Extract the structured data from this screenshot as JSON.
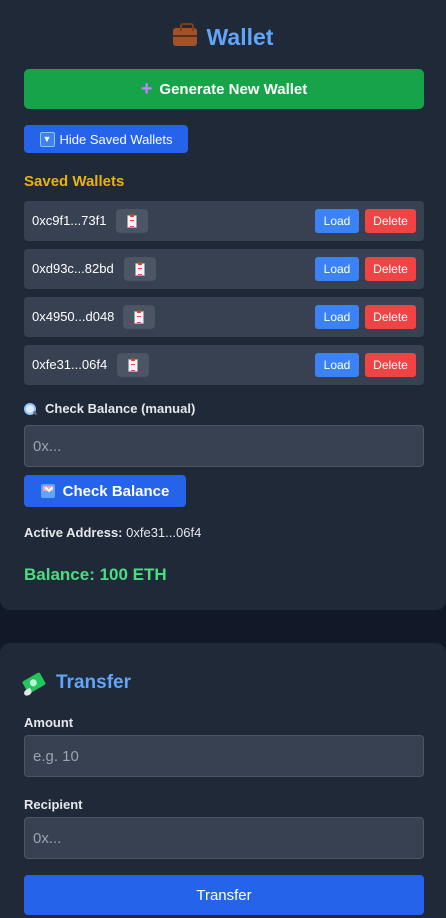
{
  "wallet": {
    "title": "Wallet",
    "title_icon": "briefcase-icon",
    "generate_label": "Generate New Wallet",
    "hide_saved_label": "Hide Saved Wallets",
    "saved_title": "Saved Wallets",
    "saved_wallets": [
      {
        "address": "0xc9f1...73f1",
        "load_label": "Load",
        "delete_label": "Delete"
      },
      {
        "address": "0xd93c...82bd",
        "load_label": "Load",
        "delete_label": "Delete"
      },
      {
        "address": "0x4950...d048",
        "load_label": "Load",
        "delete_label": "Delete"
      },
      {
        "address": "0xfe31...06f4",
        "load_label": "Load",
        "delete_label": "Delete"
      }
    ],
    "check_balance_label": "Check Balance (manual)",
    "check_input_placeholder": "0x...",
    "check_button_label": "Check Balance",
    "active_address_label": "Active Address:",
    "active_address_value": "0xfe31...06f4",
    "balance_text": "Balance: 100 ETH"
  },
  "transfer": {
    "title": "Transfer",
    "title_icon": "money-icon",
    "amount_label": "Amount",
    "amount_placeholder": "e.g. 10",
    "recipient_label": "Recipient",
    "recipient_placeholder": "0x...",
    "button_label": "Transfer"
  },
  "colors": {
    "background": "#111827",
    "card": "#1f2937",
    "row": "#374151",
    "accent_blue": "#60a5fa",
    "primary_button": "#2563eb",
    "generate_green": "#16a34a",
    "saved_title_yellow": "#eab308",
    "balance_green": "#4ade80",
    "delete_red": "#ef4444"
  }
}
